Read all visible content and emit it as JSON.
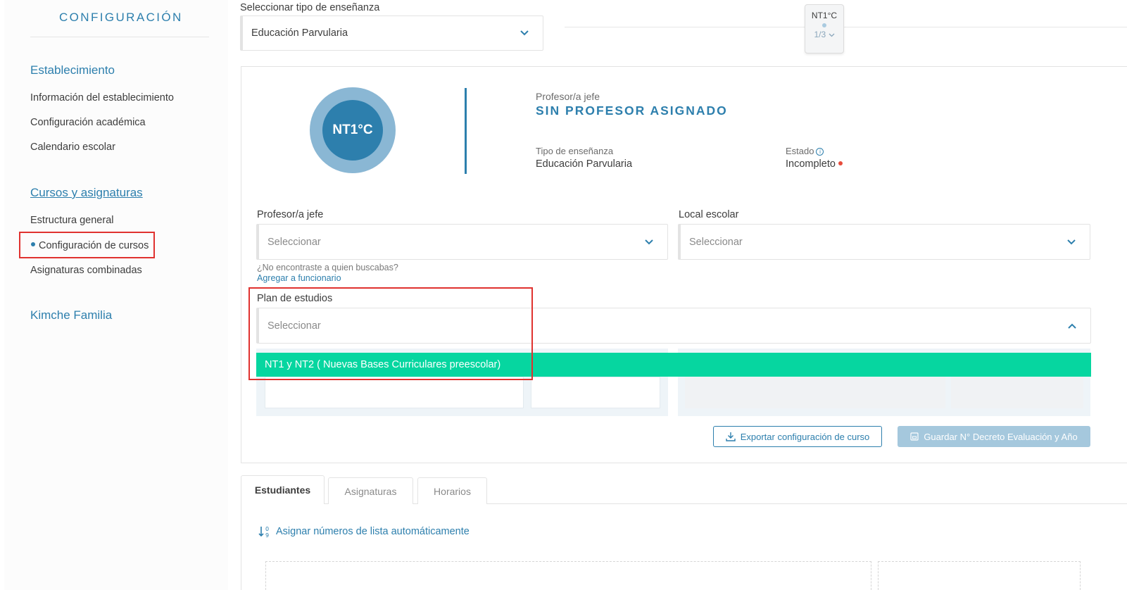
{
  "sidebar": {
    "title": "CONFIGURACIÓN",
    "sections": [
      {
        "label": "Establecimiento",
        "items": [
          "Información del establecimiento",
          "Configuración académica",
          "Calendario escolar"
        ]
      },
      {
        "label": "Cursos y asignaturas",
        "items": [
          "Estructura general",
          "Configuración de cursos",
          "Asignaturas combinadas"
        ],
        "active_item": "Configuración de cursos"
      },
      {
        "label": "Kimche Familia",
        "items": []
      }
    ]
  },
  "top": {
    "select_label": "Seleccionar tipo de enseñanza",
    "select_value": "Educación Parvularia",
    "course_tag": {
      "name": "NT1°C",
      "page": "1/3"
    }
  },
  "course": {
    "badge": "NT1°C",
    "head_teacher_label": "Profesor/a jefe",
    "head_teacher_value": "SIN PROFESOR ASIGNADO",
    "teaching_type_label": "Tipo de enseñanza",
    "teaching_type_value": "Educación Parvularia",
    "status_label": "Estado",
    "status_value": "Incompleto",
    "status_color": "#e74c3c"
  },
  "form": {
    "teacher_label": "Profesor/a jefe",
    "teacher_placeholder": "Seleccionar",
    "local_label": "Local escolar",
    "local_placeholder": "Seleccionar",
    "helper_text": "¿No encontraste a quien buscabas?",
    "helper_link": "Agregar a funcionario",
    "plan_label": "Plan de estudios",
    "plan_placeholder": "Seleccionar",
    "plan_options": [
      "NT1 y NT2 ( Nuevas Bases Curriculares preescolar)"
    ]
  },
  "actions": {
    "export_label": "Exportar configuración de curso",
    "save_label": "Guardar N° Decreto Evaluación y Año"
  },
  "tabs": [
    "Estudiantes",
    "Asignaturas",
    "Horarios"
  ],
  "active_tab": "Estudiantes",
  "assign_link": "Asignar números de lista automáticamente",
  "colors": {
    "accent": "#2d7fad",
    "option_highlight": "#06d6a0",
    "annotation": "#e0322f"
  }
}
